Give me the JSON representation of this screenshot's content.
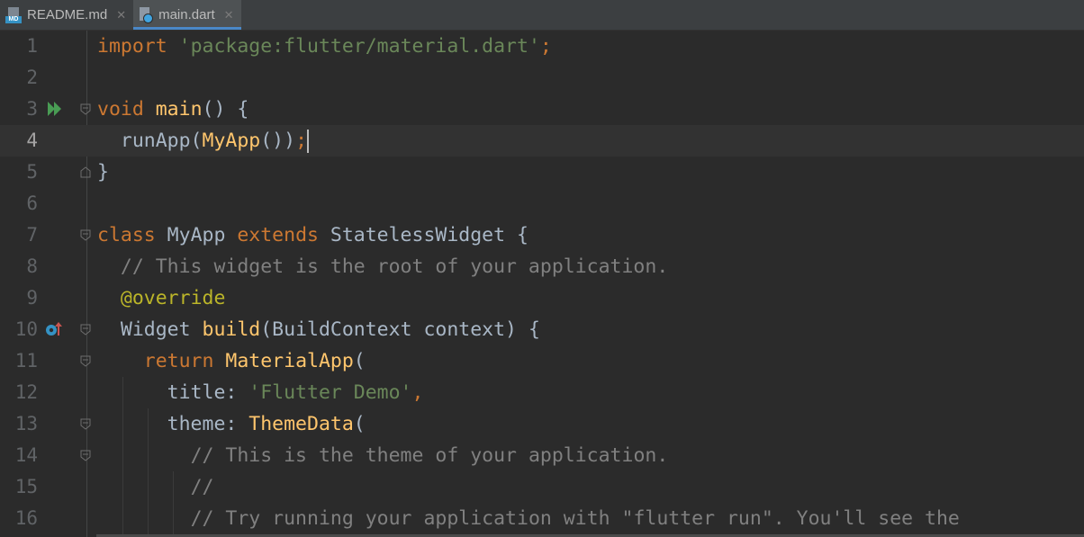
{
  "tabs": [
    {
      "label": "README.md",
      "icon": "markdown-file-icon",
      "badge": "MD",
      "active": false
    },
    {
      "label": "main.dart",
      "icon": "dart-file-icon",
      "active": true
    }
  ],
  "close_glyph": "✕",
  "editor": {
    "lines": [
      {
        "num": "1"
      },
      {
        "num": "2"
      },
      {
        "num": "3"
      },
      {
        "num": "4"
      },
      {
        "num": "5"
      },
      {
        "num": "6"
      },
      {
        "num": "7"
      },
      {
        "num": "8"
      },
      {
        "num": "9"
      },
      {
        "num": "10"
      },
      {
        "num": "11"
      },
      {
        "num": "12"
      },
      {
        "num": "13"
      },
      {
        "num": "14"
      },
      {
        "num": "15"
      },
      {
        "num": "16"
      }
    ],
    "code": {
      "l1": {
        "kw": "import",
        "str": "'package:flutter/material.dart'",
        "semi": ";"
      },
      "l3": {
        "kw": "void",
        "fn": "main",
        "rest": "() {"
      },
      "l4": {
        "call": "runApp(",
        "cls": "MyApp",
        "paren": "())",
        "semi": ";"
      },
      "l5": {
        "text": "}"
      },
      "l7": {
        "kw1": "class",
        "name": " MyApp ",
        "kw2": "extends",
        "rest": " StatelessWidget {"
      },
      "l8": {
        "comment": "// This widget is the root of your application."
      },
      "l9": {
        "at": "@",
        "ann": "override"
      },
      "l10": {
        "type": "Widget ",
        "fn": "build",
        "rest": "(BuildContext context) {"
      },
      "l11": {
        "kw": "return",
        "fn": "MaterialApp",
        "rest": "("
      },
      "l12": {
        "prop": "title: ",
        "str": "'Flutter Demo'",
        "comma": ","
      },
      "l13": {
        "prop": "theme: ",
        "fn": "ThemeData",
        "rest": "("
      },
      "l14": {
        "comment": "// This is the theme of your application."
      },
      "l15": {
        "comment": "//"
      },
      "l16": {
        "comment": "// Try running your application with \"flutter run\". You'll see the"
      }
    }
  },
  "colors": {
    "background": "#2b2b2b",
    "keyword": "#cc7832",
    "string": "#6a8759",
    "function": "#ffc66d",
    "comment": "#808080",
    "annotation": "#bbb529",
    "text": "#a9b7c6",
    "run": "#499c54"
  }
}
